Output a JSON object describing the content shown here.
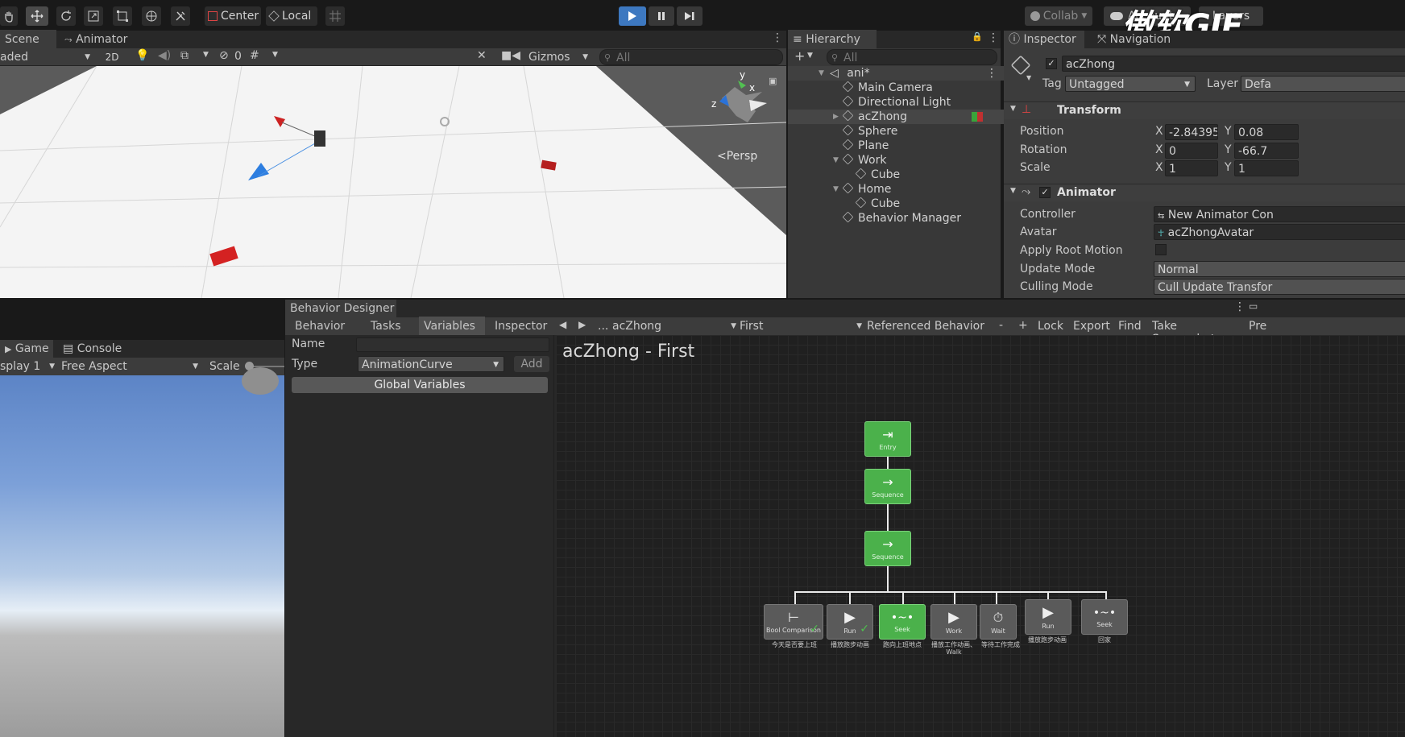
{
  "toolbar": {
    "center_label": "Center",
    "local_label": "Local",
    "collab_label": "Collab",
    "layers_label": "Layers",
    "account_label": "Account"
  },
  "watermark": "傲软GIF",
  "scene": {
    "tab_scene": "Scene",
    "tab_animator": "Animator",
    "shading": "aded",
    "mode_2d": "2D",
    "hidden_count": "0",
    "gizmos_label": "Gizmos",
    "search_placeholder": "All",
    "persp_label": "Persp",
    "axis_x": "x",
    "axis_y": "y",
    "axis_z": "z"
  },
  "hierarchy": {
    "title": "Hierarchy",
    "search_placeholder": "All",
    "root": "ani*",
    "items": [
      "Main Camera",
      "Directional Light",
      "acZhong",
      "Sphere",
      "Plane",
      "Work",
      "Cube",
      "Home",
      "Cube",
      "Behavior Manager"
    ]
  },
  "inspector": {
    "title": "Inspector",
    "navigation_tab": "Navigation",
    "object_name": "acZhong",
    "tag_label": "Tag",
    "tag_value": "Untagged",
    "layer_label": "Layer",
    "layer_value": "Defa",
    "transform": {
      "title": "Transform",
      "position_label": "Position",
      "position_x": "-2.84395",
      "position_y": "0.08",
      "rotation_label": "Rotation",
      "rotation_x": "0",
      "rotation_y": "-66.7",
      "scale_label": "Scale",
      "scale_x": "1",
      "scale_y": "1",
      "x": "X",
      "y": "Y"
    },
    "animator": {
      "title": "Animator",
      "controller_label": "Controller",
      "controller_value": "New Animator Con",
      "avatar_label": "Avatar",
      "avatar_value": "acZhongAvatar",
      "apply_root_motion_label": "Apply Root Motion",
      "update_mode_label": "Update Mode",
      "update_mode_value": "Normal",
      "culling_mode_label": "Culling Mode",
      "culling_mode_value": "Cull Update Transfor"
    }
  },
  "game": {
    "tab_game": "Game",
    "tab_console": "Console",
    "display": "splay 1",
    "aspect": "Free Aspect",
    "scale_label": "Scale"
  },
  "behavior_designer": {
    "title": "Behavior Designer",
    "tabs": [
      "Behavior",
      "Tasks",
      "Variables",
      "Inspector"
    ],
    "ellipsis": "...",
    "object_dropdown": "acZhong",
    "behavior_dropdown": "First",
    "referenced_behavior": "Referenced Behavior",
    "minus": "-",
    "plus": "+",
    "lock": "Lock",
    "export": "Export",
    "find": "Find",
    "take_screenshot": "Take Screenshot",
    "preferences": "Pre",
    "name_label": "Name",
    "type_label": "Type",
    "type_value": "AnimationCurve",
    "add_label": "Add",
    "global_variables_label": "Global Variables",
    "graph_title": "acZhong - First",
    "nodes": {
      "entry": "Entry",
      "sequence1": "Sequence",
      "sequence2": "Sequence"
    },
    "leaves": [
      {
        "type": "Bool Comparison",
        "caption": "今天是否要上班"
      },
      {
        "type": "Run",
        "caption": "播放跑步动画"
      },
      {
        "type": "Seek",
        "caption": "跑向上班地点"
      },
      {
        "type": "Work",
        "caption": "播放工作动画、Walk"
      },
      {
        "type": "Wait",
        "caption": "等待工作完成"
      },
      {
        "type": "Run",
        "caption": "播放跑步动画"
      },
      {
        "type": "Seek",
        "caption": "回家"
      }
    ]
  }
}
